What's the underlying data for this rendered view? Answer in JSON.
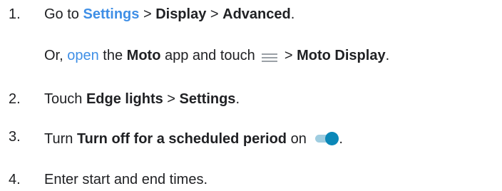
{
  "steps": [
    {
      "number": "1.",
      "parts": {
        "a": "Go to ",
        "settings": "Settings",
        "sep1": " > ",
        "display": "Display",
        "sep2": " > ",
        "advanced": "Advanced",
        "end": "."
      }
    },
    {
      "alt": {
        "a": "Or, ",
        "open": "open",
        "b": " the ",
        "moto": "Moto",
        "c": " app and touch ",
        "d": " > ",
        "moto_display": "Moto Display",
        "end": "."
      }
    },
    {
      "number": "2.",
      "parts": {
        "a": "Touch ",
        "edge_lights": "Edge lights",
        "sep": " > ",
        "settings": "Settings",
        "end": "."
      }
    },
    {
      "number": "3.",
      "parts": {
        "a": "Turn ",
        "option": "Turn off for a scheduled period",
        "b": " on ",
        "end": "."
      }
    },
    {
      "number": "4.",
      "parts": {
        "a": "Enter start and end times."
      }
    }
  ],
  "icons": {
    "menu": "menu-icon",
    "toggle": "toggle-switch-on-icon"
  },
  "colors": {
    "link": "#3f8fe6",
    "text": "#202124",
    "toggle_track": "#9fcde0",
    "toggle_knob": "#0b88b8"
  }
}
